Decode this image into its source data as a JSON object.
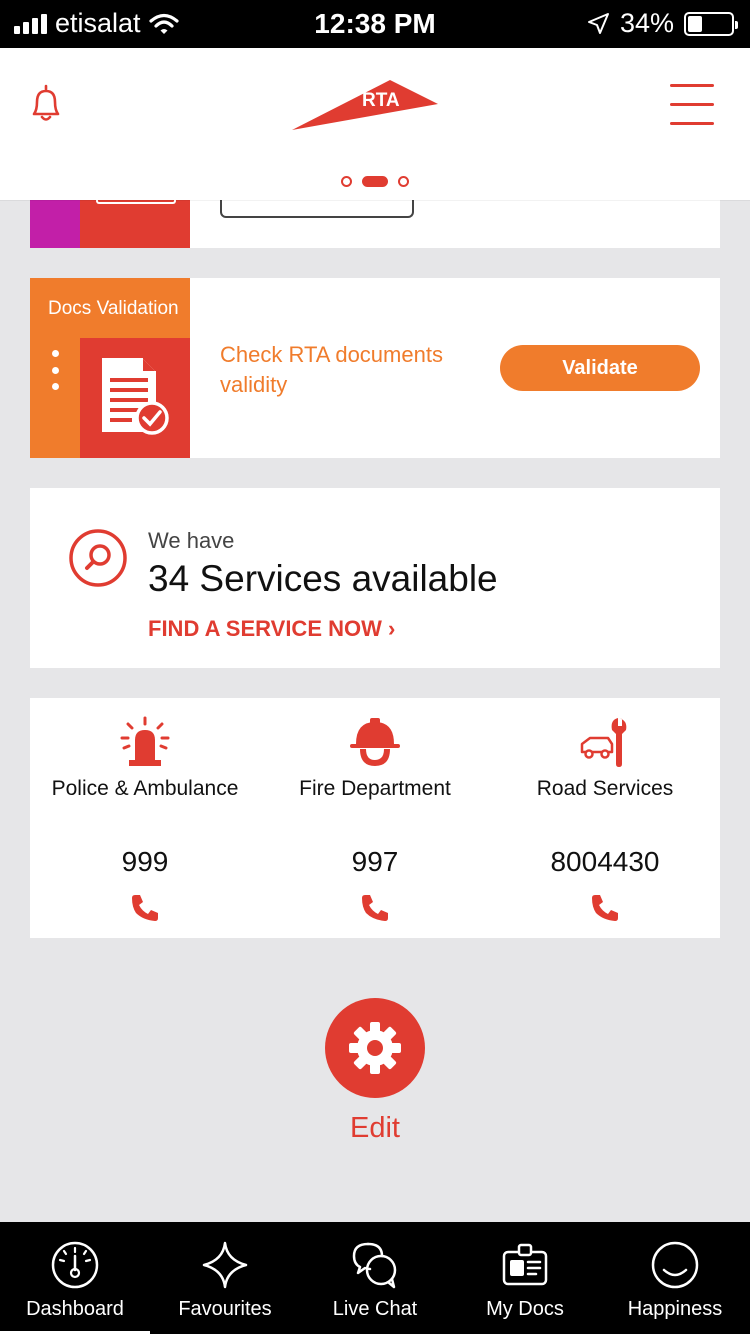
{
  "status_bar": {
    "carrier": "etisalat",
    "time": "12:38 PM",
    "battery": "34%",
    "battery_level": 0.34
  },
  "header": {
    "logo_text": "RTA",
    "carousel_index": 1,
    "carousel_count": 3,
    "brand_color": "#e03c31"
  },
  "docs_card": {
    "label": "Docs Validation",
    "description": "Check RTA documents validity",
    "button": "Validate",
    "accent_color": "#f07c2c"
  },
  "services_card": {
    "intro": "We have",
    "count_text": "34 Services available",
    "link": "FIND A SERVICE NOW ›"
  },
  "emergency": [
    {
      "label": "Police & Ambulance",
      "number": "999",
      "icon": "siren-icon"
    },
    {
      "label": "Fire Department",
      "number": "997",
      "icon": "fire-helmet-icon"
    },
    {
      "label": "Road Services",
      "number": "8004430",
      "icon": "car-wrench-icon"
    }
  ],
  "edit": {
    "label": "Edit",
    "icon": "gear-icon"
  },
  "tabs": [
    {
      "label": "Dashboard",
      "icon": "dashboard-gauge-icon",
      "active": true
    },
    {
      "label": "Favourites",
      "icon": "star-icon",
      "active": false
    },
    {
      "label": "Live Chat",
      "icon": "chat-bubbles-icon",
      "active": false
    },
    {
      "label": "My Docs",
      "icon": "id-card-icon",
      "active": false
    },
    {
      "label": "Happiness",
      "icon": "smile-icon",
      "active": false
    }
  ]
}
